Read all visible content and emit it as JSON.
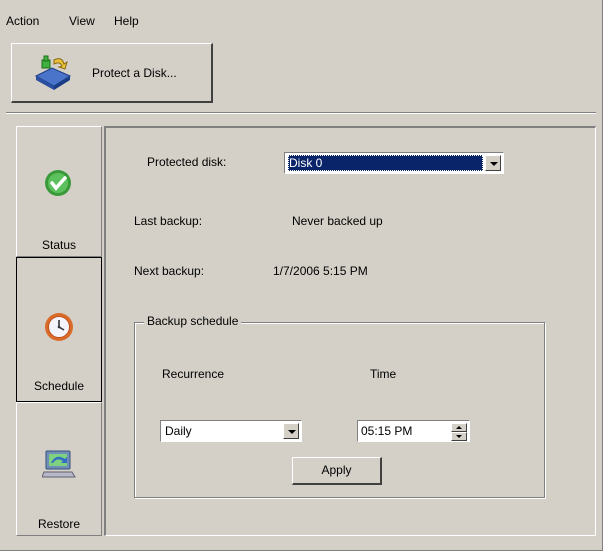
{
  "menu": {
    "items": [
      "Action",
      "View",
      "Help"
    ]
  },
  "toolbar": {
    "protect_label": "Protect a Disk...",
    "icon": "protect-disk-icon"
  },
  "nav": {
    "items": [
      {
        "label": "Status",
        "icon": "green-check-icon"
      },
      {
        "label": "Schedule",
        "icon": "clock-icon"
      },
      {
        "label": "Restore",
        "icon": "restore-computer-icon"
      }
    ],
    "selected": "Schedule"
  },
  "content": {
    "protected_disk_label": "Protected disk:",
    "protected_disk_value": "Disk 0",
    "last_backup_label": "Last backup:",
    "last_backup_value": "Never backed up",
    "next_backup_label": "Next backup:",
    "next_backup_value": "1/7/2006 5:15 PM"
  },
  "schedule": {
    "group_title": "Backup schedule",
    "recurrence_label": "Recurrence",
    "time_label": "Time",
    "recurrence_value": "Daily",
    "time_value": "05:15 PM",
    "apply_label": "Apply"
  },
  "colors": {
    "face": "#d4d0c8",
    "highlight": "#0a246a",
    "check": "#3a9a3a",
    "clock": "#d86a2a"
  }
}
